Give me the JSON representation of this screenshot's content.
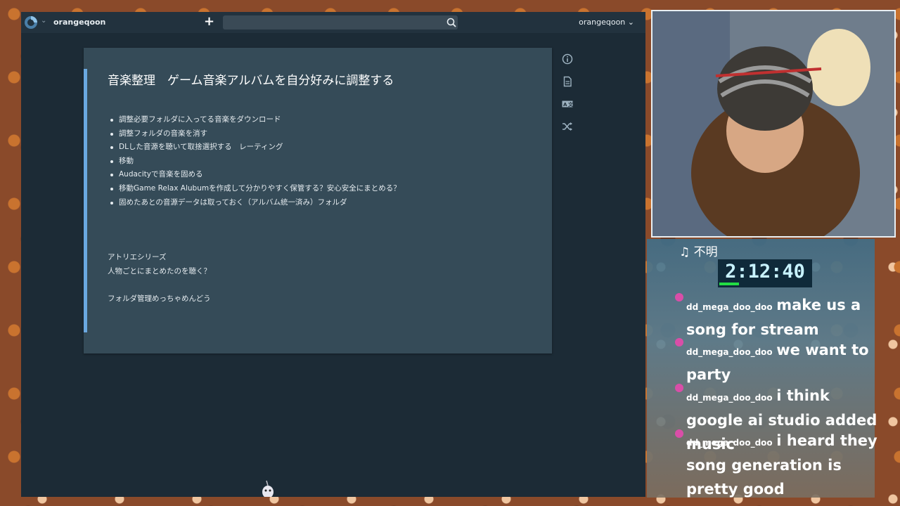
{
  "topbar": {
    "username_left": "orangeqoon",
    "username_right": "orangeqoon",
    "search_placeholder": ""
  },
  "note": {
    "title": "音楽整理　ゲーム音楽アルバムを自分好みに調整する",
    "items": [
      "調整必要フォルダに入ってる音楽をダウンロード",
      "調整フォルダの音楽を消す",
      "DLした音源を聴いて取捨選択する　レーティング",
      "移動",
      "Audacityで音楽を固める",
      "移動Game Relax Alubumを作成して分かりやすく保管する？安心安全にまとめる？",
      "固めたあとの音源データは取っておく（アルバム統一済み）フォルダ"
    ],
    "para1": "アトリエシリーズ",
    "para2": "人物ごとにまとめたのを聴く？",
    "para3": "フォルダ管理めっちゃめんどう"
  },
  "overlay": {
    "now_playing": "♫ 不明",
    "timer": "2:12:40",
    "chat": [
      {
        "user": "dd_mega_doo_doo",
        "text": "make us a song for stream"
      },
      {
        "user": "dd_mega_doo_doo",
        "text": "we want to party"
      },
      {
        "user": "dd_mega_doo_doo",
        "text": "i think google ai studio added music"
      },
      {
        "user": "dd_mega_doo_doo",
        "text": "i heard they song generation is pretty good"
      }
    ]
  },
  "colors": {
    "app_bg": "#1c2b36",
    "card_bg": "#354b58",
    "accent": "#6aa8e0"
  },
  "icons": [
    "logo-icon",
    "add-icon",
    "search-icon",
    "info-icon",
    "document-icon",
    "translate-icon",
    "shuffle-icon"
  ]
}
